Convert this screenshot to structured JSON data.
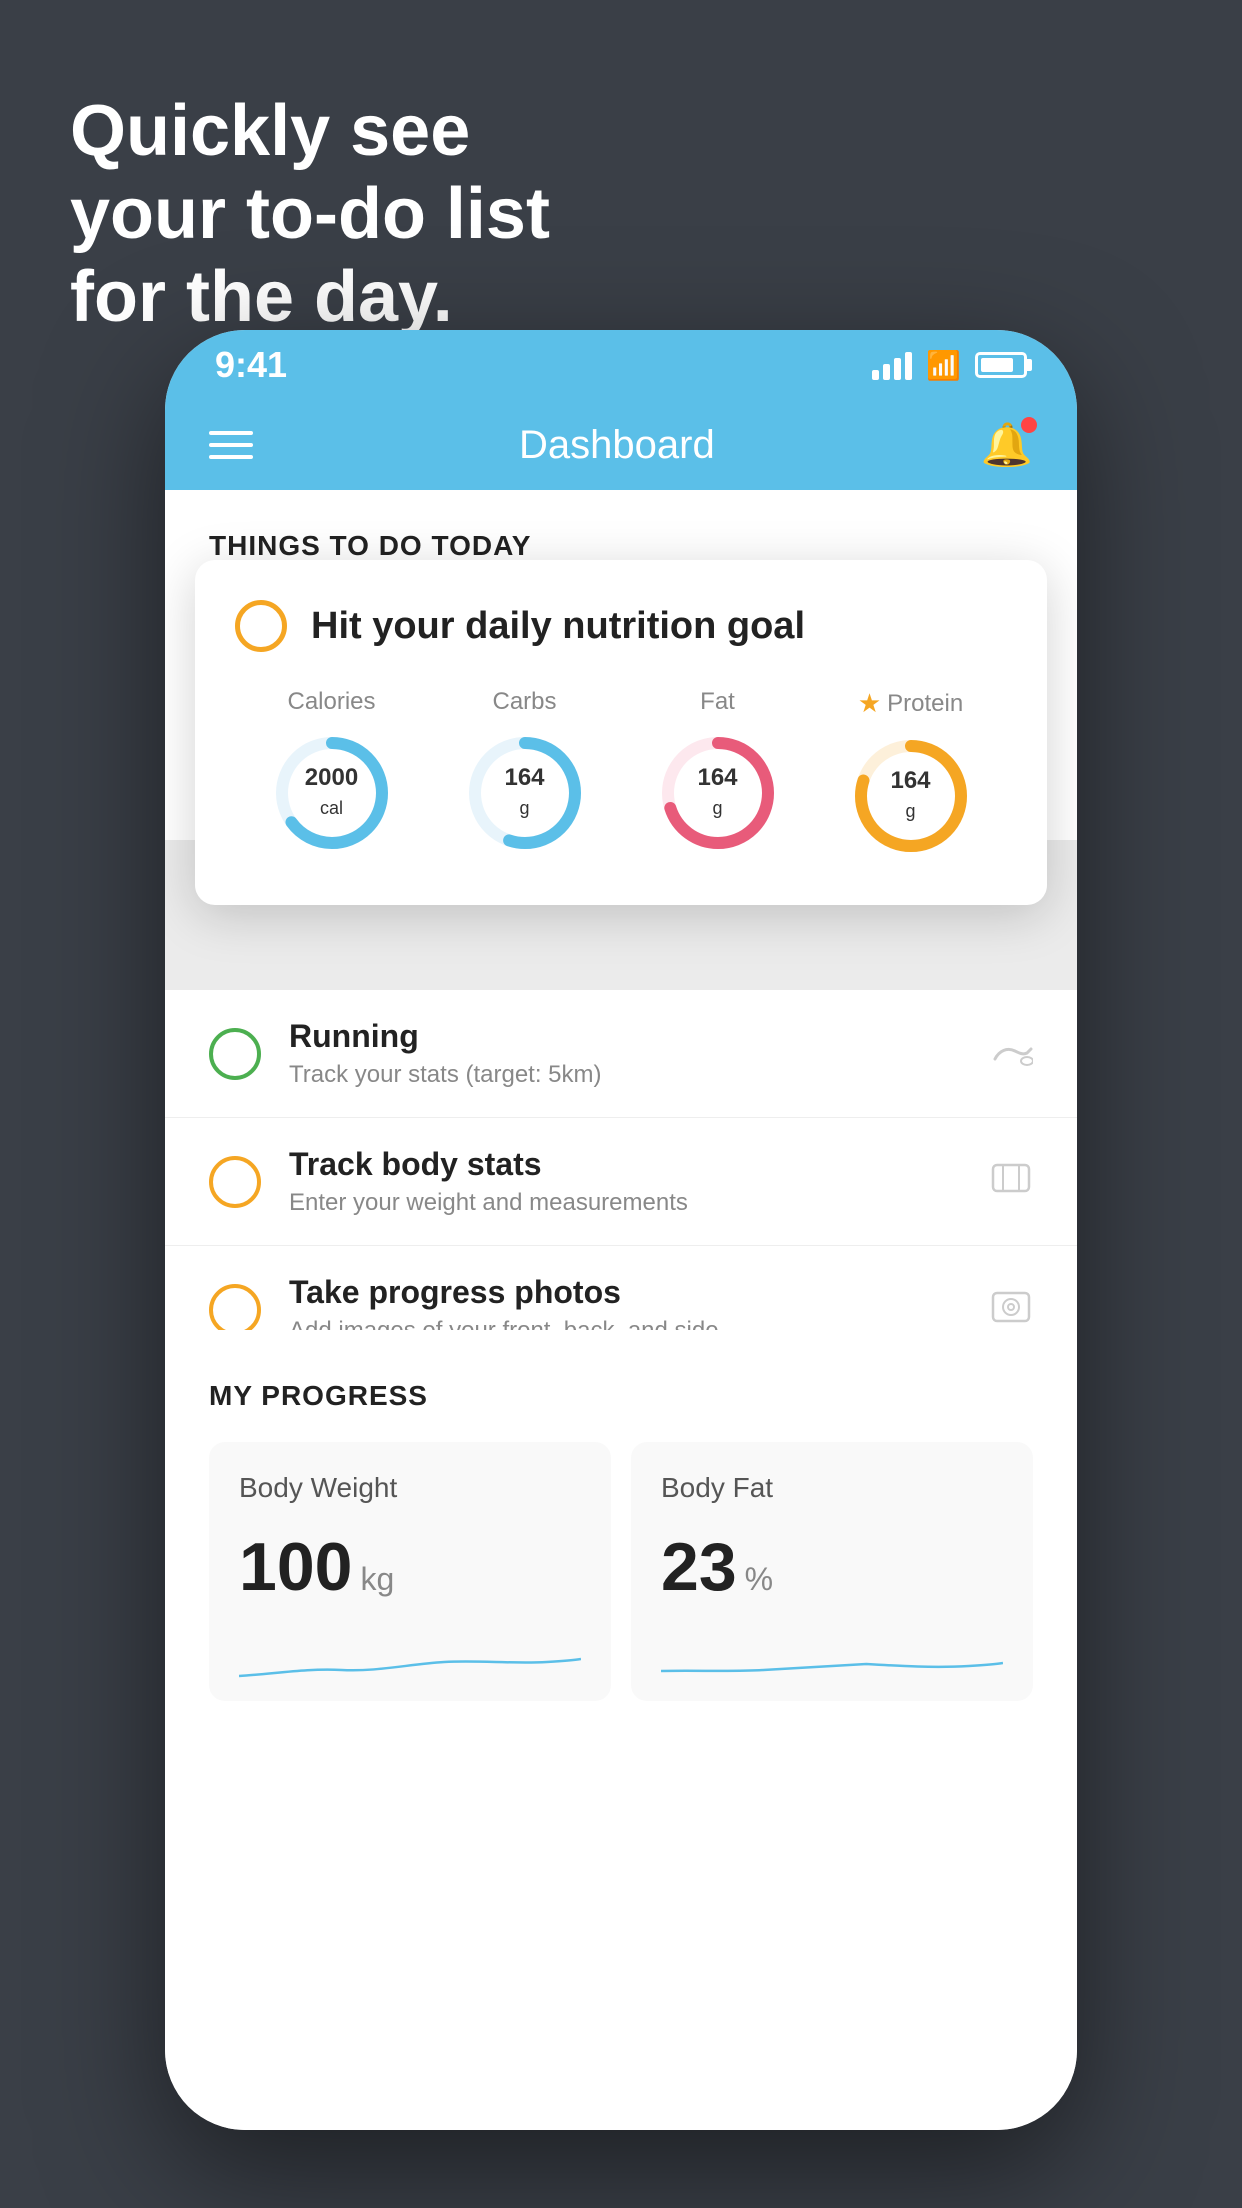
{
  "headline": {
    "line1": "Quickly see",
    "line2": "your to-do list",
    "line3": "for the day."
  },
  "status_bar": {
    "time": "9:41"
  },
  "header": {
    "title": "Dashboard"
  },
  "things_section": {
    "label": "THINGS TO DO TODAY"
  },
  "nutrition_card": {
    "title": "Hit your daily nutrition goal",
    "items": [
      {
        "label": "Calories",
        "value": "2000",
        "unit": "cal",
        "color": "#5bbfe8",
        "percent": 65,
        "starred": false
      },
      {
        "label": "Carbs",
        "value": "164",
        "unit": "g",
        "color": "#5bbfe8",
        "percent": 55,
        "starred": false
      },
      {
        "label": "Fat",
        "value": "164",
        "unit": "g",
        "color": "#e85b7a",
        "percent": 70,
        "starred": false
      },
      {
        "label": "Protein",
        "value": "164",
        "unit": "g",
        "color": "#f5a623",
        "percent": 80,
        "starred": true
      }
    ]
  },
  "todo_items": [
    {
      "title": "Running",
      "subtitle": "Track your stats (target: 5km)",
      "circle_color": "green",
      "icon": "👟"
    },
    {
      "title": "Track body stats",
      "subtitle": "Enter your weight and measurements",
      "circle_color": "yellow",
      "icon": "⚖️"
    },
    {
      "title": "Take progress photos",
      "subtitle": "Add images of your front, back, and side",
      "circle_color": "yellow",
      "icon": "🖼️"
    }
  ],
  "progress_section": {
    "label": "MY PROGRESS",
    "cards": [
      {
        "title": "Body Weight",
        "value": "100",
        "unit": "kg"
      },
      {
        "title": "Body Fat",
        "value": "23",
        "unit": "%"
      }
    ]
  }
}
